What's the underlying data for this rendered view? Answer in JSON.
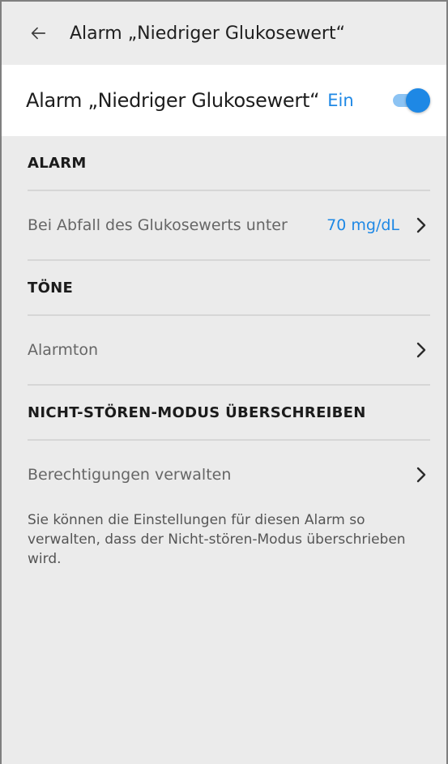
{
  "header": {
    "title": "Alarm „Niedriger Glukosewert“",
    "back_icon": "arrow-left-icon"
  },
  "alarm_toggle": {
    "label": "Alarm „Niedriger Glukosewert“",
    "state_text": "Ein",
    "enabled": true,
    "accent_color": "#1e88e5"
  },
  "sections": {
    "alarm": {
      "heading": "ALARM",
      "row_label": "Bei Abfall des Glukosewerts unter",
      "row_value": "70 mg/dL"
    },
    "tones": {
      "heading": "TÖNE",
      "row_label": "Alarmton"
    },
    "dnd_override": {
      "heading": "NICHT-STÖREN-MODUS ÜBERSCHREIBEN",
      "row_label": "Berechtigungen verwalten",
      "description": "Sie können die Einstellungen für diesen Alarm so verwalten, dass der Nicht-stören-Modus überschrieben wird."
    }
  }
}
